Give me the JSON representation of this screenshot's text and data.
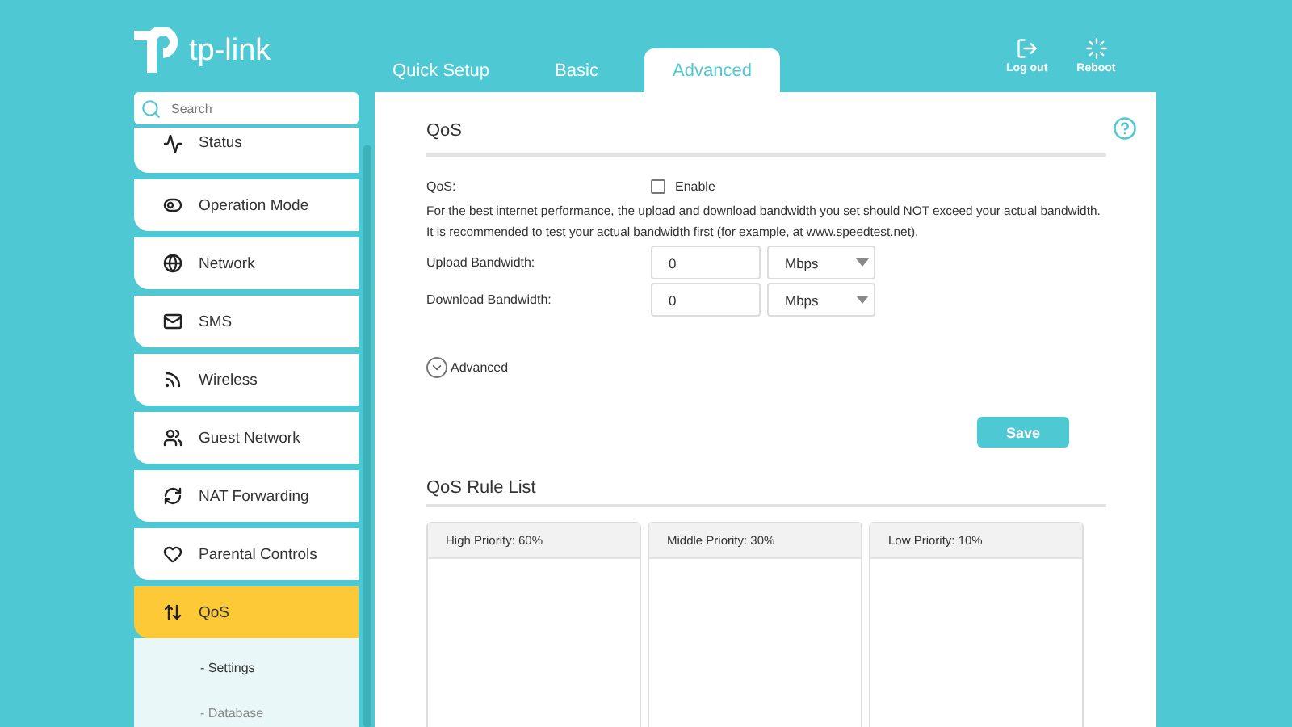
{
  "logo": {
    "text": "tp-link"
  },
  "tabs": [
    {
      "label": "Quick Setup",
      "selected": false
    },
    {
      "label": "Basic",
      "selected": false
    },
    {
      "label": "Advanced",
      "selected": true
    }
  ],
  "header_actions": [
    {
      "kind": "logout",
      "label": "Log out"
    },
    {
      "kind": "reboot",
      "label": "Reboot"
    }
  ],
  "search": {
    "placeholder": "Search"
  },
  "sidebar": {
    "items": [
      {
        "kind": "status",
        "label": "Status",
        "selected": false
      },
      {
        "kind": "mode",
        "label": "Operation Mode",
        "selected": false
      },
      {
        "kind": "network",
        "label": "Network",
        "selected": false
      },
      {
        "kind": "sms",
        "label": "SMS",
        "selected": false
      },
      {
        "kind": "wireless",
        "label": "Wireless",
        "selected": false
      },
      {
        "kind": "guest",
        "label": "Guest Network",
        "selected": false
      },
      {
        "kind": "nat",
        "label": "NAT Forwarding",
        "selected": false
      },
      {
        "kind": "parental",
        "label": "Parental Controls",
        "selected": false
      },
      {
        "kind": "qos",
        "label": "QoS",
        "selected": true,
        "children": [
          {
            "label": "- Settings",
            "selected": true
          },
          {
            "label": "- Database",
            "selected": false
          }
        ]
      }
    ]
  },
  "section": {
    "title": "QoS",
    "qos_label": "QoS:",
    "enable": {
      "label": "Enable",
      "checked": false
    },
    "note": "For the best internet performance, the upload and download bandwidth you set should NOT exceed your actual bandwidth. It is recommended to test your actual bandwidth first (for example, at www.speedtest.net).",
    "fields": [
      {
        "label": "Upload Bandwidth:",
        "value": "0",
        "unit": "Mbps"
      },
      {
        "label": "Download Bandwidth:",
        "value": "0",
        "unit": "Mbps"
      }
    ],
    "advanced": {
      "label": "Advanced",
      "expanded": false
    },
    "save": "Save"
  },
  "rule_list": {
    "title": "QoS Rule List",
    "columns": [
      {
        "header": "High Priority: 60%"
      },
      {
        "header": "Middle Priority: 30%"
      },
      {
        "header": "Low Priority: 10%"
      }
    ]
  }
}
